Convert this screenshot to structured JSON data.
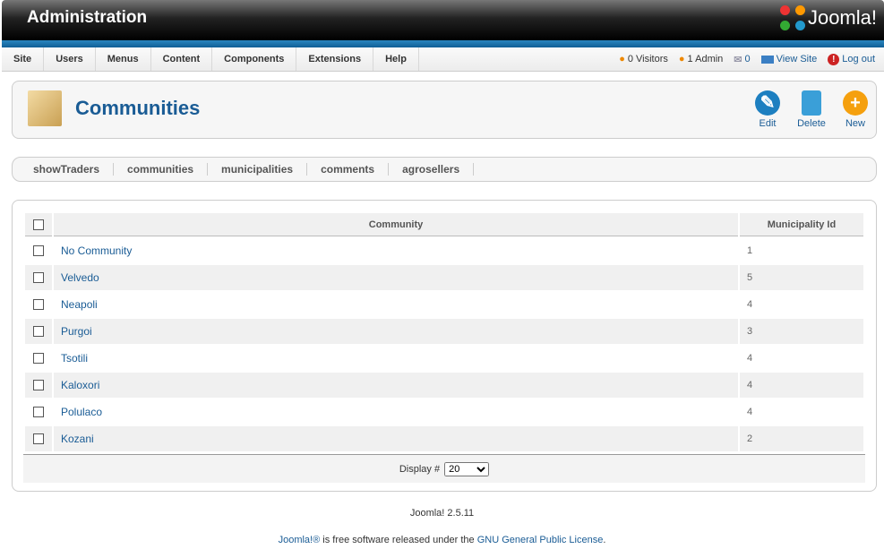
{
  "header": {
    "title": "Administration",
    "logo_text": "Joomla!"
  },
  "menu": [
    "Site",
    "Users",
    "Menus",
    "Content",
    "Components",
    "Extensions",
    "Help"
  ],
  "status": {
    "visitors": "0 Visitors",
    "admins": "1 Admin",
    "messages": "0",
    "view_site": "View Site",
    "logout": "Log out"
  },
  "toolbar": {
    "title": "Communities",
    "edit": "Edit",
    "delete": "Delete",
    "new": "New"
  },
  "submenu": [
    "showTraders",
    "communities",
    "municipalities",
    "comments",
    "agrosellers"
  ],
  "table": {
    "headers": [
      "Community",
      "Municipality Id"
    ],
    "rows": [
      [
        "No Community",
        "1"
      ],
      [
        "Velvedo",
        "5"
      ],
      [
        "Neapoli",
        "4"
      ],
      [
        "Purgoi",
        "3"
      ],
      [
        "Tsotili",
        "4"
      ],
      [
        "Kaloxori",
        "4"
      ],
      [
        "Polulaco",
        "4"
      ],
      [
        "Kozani",
        "2"
      ]
    ]
  },
  "pagination": {
    "label": "Display #",
    "value": "20"
  },
  "footer": {
    "version": "Joomla! 2.5.11",
    "lic_pre": "Joomla!®",
    "lic_mid": " is free software released under the ",
    "lic_link": "GNU General Public License",
    "lic_end": "."
  }
}
